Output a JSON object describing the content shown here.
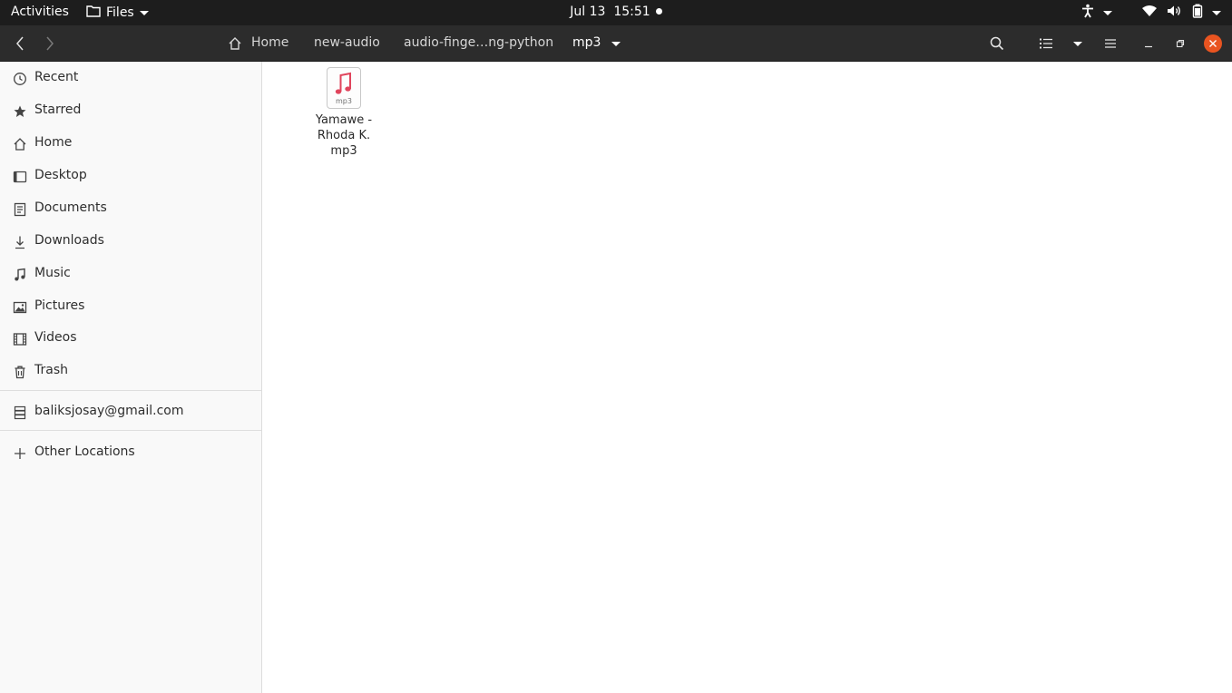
{
  "topbar": {
    "activities": "Activities",
    "app_name": "Files",
    "date": "Jul 13",
    "time": "15:51"
  },
  "headerbar": {
    "breadcrumbs": [
      "Home",
      "new-audio",
      "audio-finge…ng-python",
      "mp3"
    ]
  },
  "sidebar": {
    "items": [
      {
        "label": "Recent",
        "icon": "clock-icon"
      },
      {
        "label": "Starred",
        "icon": "star-icon"
      },
      {
        "label": "Home",
        "icon": "home-icon"
      },
      {
        "label": "Desktop",
        "icon": "desktop-icon"
      },
      {
        "label": "Documents",
        "icon": "document-icon"
      },
      {
        "label": "Downloads",
        "icon": "download-icon"
      },
      {
        "label": "Music",
        "icon": "music-icon"
      },
      {
        "label": "Pictures",
        "icon": "picture-icon"
      },
      {
        "label": "Videos",
        "icon": "film-icon"
      },
      {
        "label": "Trash",
        "icon": "trash-icon"
      }
    ],
    "account": {
      "label": "baliksjosay@gmail.com",
      "icon": "server-icon"
    },
    "other_locations": {
      "label": "Other Locations",
      "icon": "plus-icon"
    }
  },
  "files": [
    {
      "name_lines": [
        "Yamawe -",
        "Rhoda K.",
        "mp3"
      ],
      "ext": "mp3",
      "icon": "audio-file-icon"
    }
  ],
  "colors": {
    "topbar_bg": "#1d1d1d",
    "headerbar_bg": "#2c2c2c",
    "sidebar_bg": "#f9f9f9",
    "close_button": "#e95420",
    "music_accent": "#e0445c"
  }
}
